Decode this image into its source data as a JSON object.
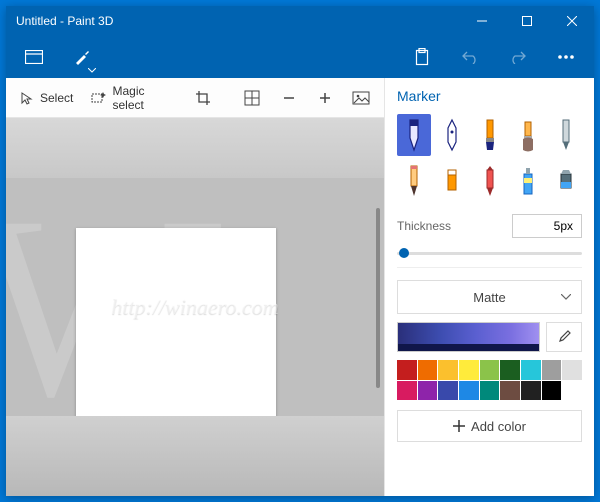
{
  "window": {
    "title": "Untitled - Paint 3D"
  },
  "toolbar": {
    "select": "Select",
    "magic_select": "Magic select"
  },
  "panel": {
    "heading": "Marker",
    "thickness_label": "Thickness",
    "thickness_value": "5px",
    "material": "Matte",
    "add_color": "Add color",
    "tools": [
      "marker",
      "calligraphy-pen",
      "oil-brush",
      "spray-can",
      "watercolor",
      "pencil",
      "eraser",
      "crayon",
      "pixel-pen",
      "fill"
    ],
    "palette": [
      "#c41e1e",
      "#ef6c00",
      "#fbc02d",
      "#ffeb3b",
      "#8bc34a",
      "#1b5e20",
      "#26c6da",
      "#9e9e9e",
      "#e0e0e0",
      "#d81b60",
      "#8e24aa",
      "#3949ab",
      "#1e88e5",
      "#00897b",
      "#6d4c41",
      "#212121",
      "#000000",
      "#ffffff"
    ]
  },
  "watermark": "http://winaero.com"
}
